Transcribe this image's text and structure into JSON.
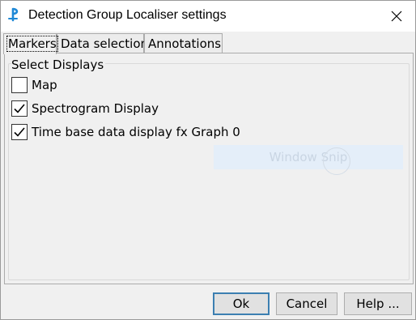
{
  "window": {
    "title": "Detection Group Localiser settings"
  },
  "tabs": [
    {
      "label": "Markers",
      "active": true
    },
    {
      "label": "Data selection",
      "active": false
    },
    {
      "label": "Annotations",
      "active": false
    }
  ],
  "group": {
    "title": "Select Displays",
    "items": [
      {
        "label": "Map",
        "checked": false
      },
      {
        "label": "Spectrogram Display",
        "checked": true
      },
      {
        "label": "Time base data display fx Graph 0",
        "checked": true
      }
    ]
  },
  "overlay": {
    "text": "Window Snip"
  },
  "buttons": {
    "ok": "Ok",
    "cancel": "Cancel",
    "help": "Help ..."
  },
  "icons": {
    "app": "pamguard-app-icon",
    "close": "close-icon",
    "check": "check-icon"
  },
  "colors": {
    "accent": "#3c7fb1",
    "app_icon": "#1e88d6"
  }
}
